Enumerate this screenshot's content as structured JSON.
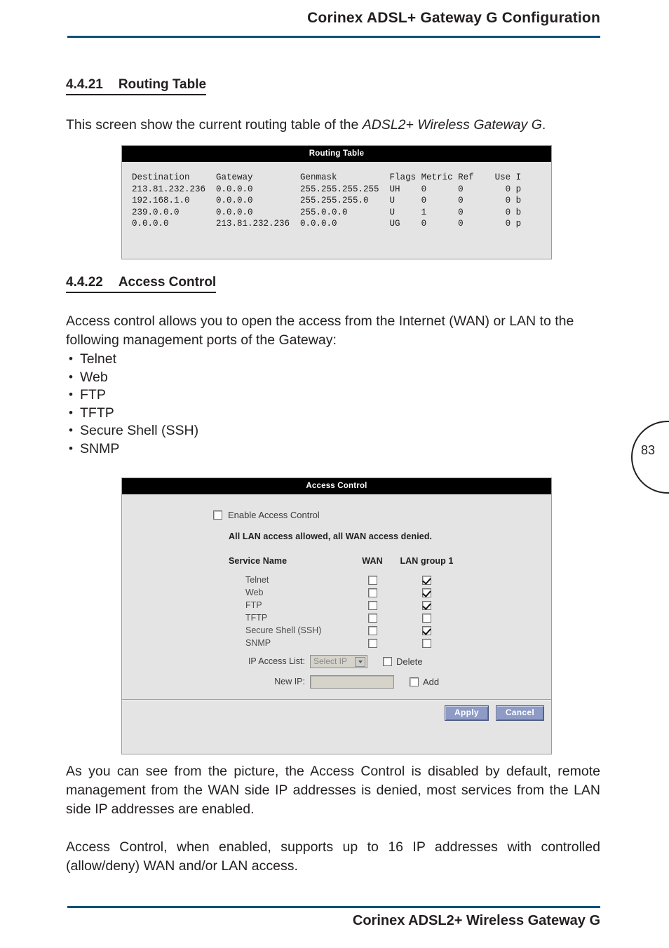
{
  "header": {
    "title": "Corinex ADSL+ Gateway G Configuration",
    "accent_color": "#0f5277"
  },
  "footer": {
    "title": "Corinex ADSL2+ Wireless Gateway G"
  },
  "page_number": "83",
  "sections": [
    {
      "number": "4.4.21",
      "title": "Routing Table",
      "intro_before": "This screen show the current routing table of the ",
      "intro_italic": "ADSL2+ Wireless Gateway G",
      "intro_after": "."
    },
    {
      "number": "4.4.22",
      "title": "Access Control",
      "intro": "Access control allows you to open the access from the Internet (WAN) or LAN to the following management ports of the Gateway:",
      "bullets": [
        "Telnet",
        "Web",
        "FTP",
        "TFTP",
        "Secure Shell (SSH)",
        "SNMP"
      ]
    }
  ],
  "routing_table_shot": {
    "title": "Routing Table",
    "text": "Destination     Gateway         Genmask          Flags Metric Ref    Use I\n213.81.232.236  0.0.0.0         255.255.255.255  UH    0      0        0 p\n192.168.1.0     0.0.0.0         255.255.255.0    U     0      0        0 b\n239.0.0.0       0.0.0.0         255.0.0.0        U     1      0        0 b\n0.0.0.0         213.81.232.236  0.0.0.0          UG    0      0        0 p",
    "columns": [
      "Destination",
      "Gateway",
      "Genmask",
      "Flags",
      "Metric",
      "Ref",
      "Use",
      "I"
    ],
    "rows": [
      {
        "destination": "213.81.232.236",
        "gateway": "0.0.0.0",
        "genmask": "255.255.255.255",
        "flags": "UH",
        "metric": "0",
        "ref": "0",
        "use": "0",
        "iface": "p"
      },
      {
        "destination": "192.168.1.0",
        "gateway": "0.0.0.0",
        "genmask": "255.255.255.0",
        "flags": "U",
        "metric": "0",
        "ref": "0",
        "use": "0",
        "iface": "b"
      },
      {
        "destination": "239.0.0.0",
        "gateway": "0.0.0.0",
        "genmask": "255.0.0.0",
        "flags": "U",
        "metric": "1",
        "ref": "0",
        "use": "0",
        "iface": "b"
      },
      {
        "destination": "0.0.0.0",
        "gateway": "213.81.232.236",
        "genmask": "0.0.0.0",
        "flags": "UG",
        "metric": "0",
        "ref": "0",
        "use": "0",
        "iface": "p"
      }
    ]
  },
  "access_control_shot": {
    "title": "Access Control",
    "enable_label": "Enable Access Control",
    "enable_checked": false,
    "status_note": "All LAN access allowed, all WAN access denied.",
    "col_service": "Service Name",
    "col_wan": "WAN",
    "col_lan": "LAN group 1",
    "services": [
      {
        "name": "Telnet",
        "wan": false,
        "lan": true
      },
      {
        "name": "Web",
        "wan": false,
        "lan": true
      },
      {
        "name": "FTP",
        "wan": false,
        "lan": true
      },
      {
        "name": "TFTP",
        "wan": false,
        "lan": false
      },
      {
        "name": "Secure Shell (SSH)",
        "wan": false,
        "lan": true
      },
      {
        "name": "SNMP",
        "wan": false,
        "lan": false
      }
    ],
    "ip_access_list_label": "IP Access List:",
    "ip_access_list_value": "Select IP",
    "delete_label": "Delete",
    "delete_checked": false,
    "new_ip_label": "New IP:",
    "new_ip_value": "",
    "add_label": "Add",
    "add_checked": false,
    "apply_label": "Apply",
    "cancel_label": "Cancel"
  },
  "closing_paragraphs": [
    "As you can see from the picture, the Access Control is disabled by default, remote management from the WAN side IP addresses is denied, most services from the LAN side IP addresses are enabled.",
    "Access Control, when enabled, supports up to 16 IP addresses with controlled (allow/deny) WAN and/or LAN access."
  ]
}
